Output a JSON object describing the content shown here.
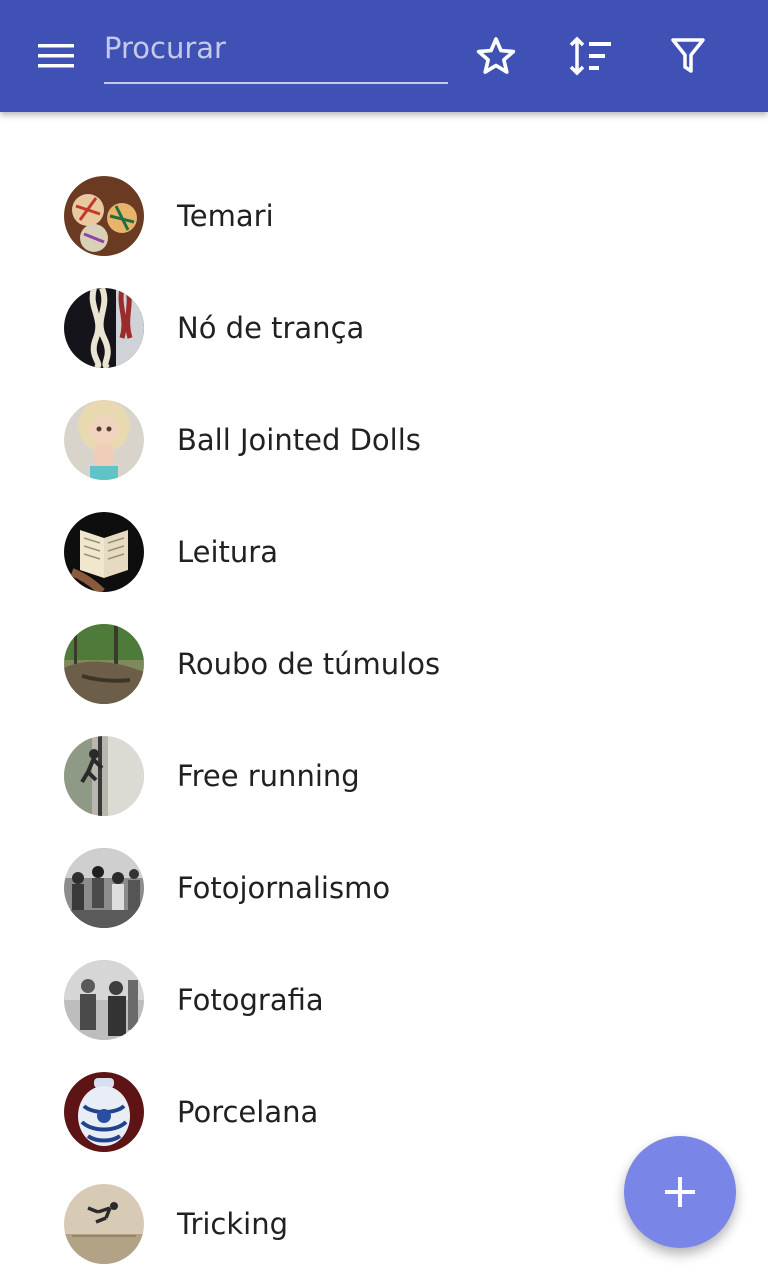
{
  "toolbar": {
    "search_placeholder": "Procurar",
    "search_value": "",
    "menu_icon": "menu-icon",
    "favorites_icon": "star-outline-icon",
    "sort_icon": "sort-icon",
    "filter_icon": "filter-icon"
  },
  "items": [
    {
      "label": "Temari",
      "avatar": "temari-photo"
    },
    {
      "label": "Nó de trança",
      "avatar": "braided-rope-photo"
    },
    {
      "label": "Ball Jointed Dolls",
      "avatar": "doll-photo"
    },
    {
      "label": "Leitura",
      "avatar": "book-photo"
    },
    {
      "label": "Roubo de túmulos",
      "avatar": "forest-grave-photo"
    },
    {
      "label": "Free running",
      "avatar": "parkour-photo"
    },
    {
      "label": "Fotojornalismo",
      "avatar": "bw-crowd-photo"
    },
    {
      "label": "Fotografia",
      "avatar": "bw-portrait-photo"
    },
    {
      "label": "Porcelana",
      "avatar": "porcelain-jar-photo"
    },
    {
      "label": "Tricking",
      "avatar": "flip-photo"
    }
  ],
  "fab": {
    "icon": "plus-icon"
  },
  "colors": {
    "primary": "#3f51b5",
    "accent": "#7986e8",
    "text": "#212121"
  }
}
